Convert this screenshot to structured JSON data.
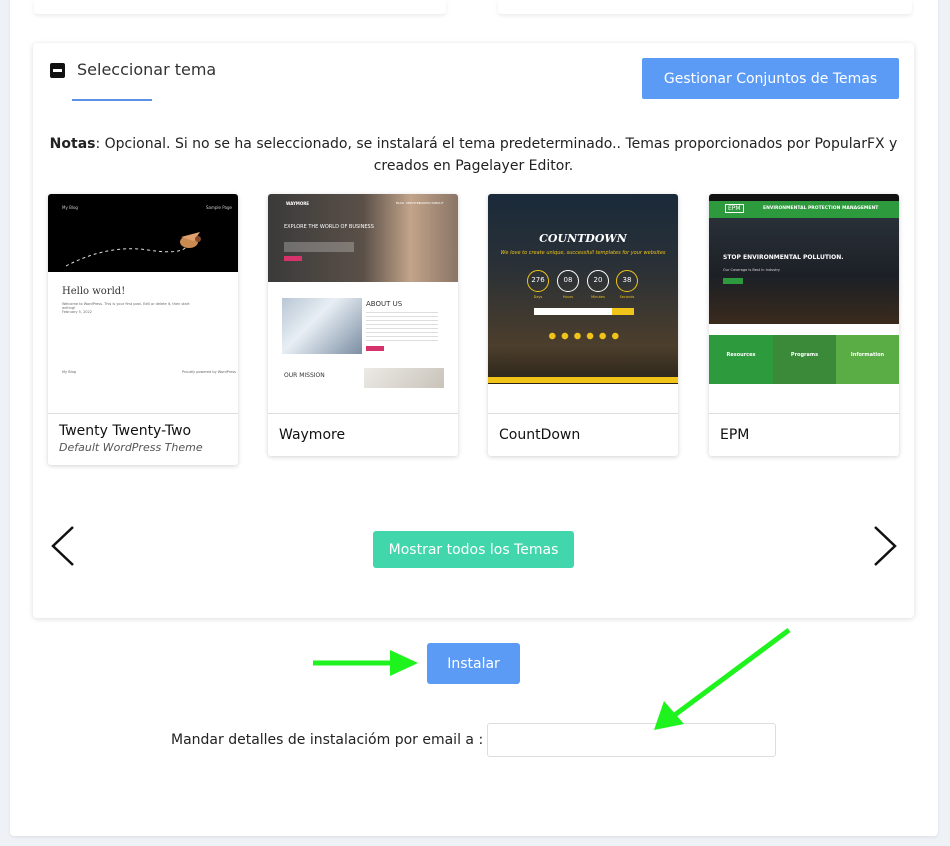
{
  "section": {
    "title": "Seleccionar tema",
    "manage_button": "Gestionar Conjuntos de Temas"
  },
  "notes": {
    "label": "Notas",
    "text": ": Opcional. Si no se ha seleccionado, se instalará el tema predeterminado.. Temas proporcionados por PopularFX y creados en Pagelayer Editor."
  },
  "themes": [
    {
      "name": "Twenty Twenty-Two",
      "description": "Default WordPress Theme",
      "preview": {
        "site_name": "My Blog",
        "top_link": "Sample Page",
        "heading": "Hello world!",
        "body": "Welcome to WordPress. This is your first post. Edit or delete it, then start writing!",
        "date": "February 5, 2022",
        "footer_left": "My Blog",
        "footer_right": "Proudly powered by WordPress"
      }
    },
    {
      "name": "Waymore",
      "description": "",
      "preview": {
        "logo": "WAYMORE",
        "nav": [
          "BLOG",
          "SERVICES",
          "CONTACT",
          "ABOUT"
        ],
        "hero": "EXPLORE THE WORLD OF BUSINESS",
        "about": "ABOUT US",
        "mission": "OUR MISSION"
      }
    },
    {
      "name": "CountDown",
      "description": "",
      "preview": {
        "title": "COUNTDOWN",
        "tagline": "We love to create unique, successfull templates for your websites",
        "counts": [
          "276",
          "08",
          "20",
          "38"
        ],
        "units": [
          "Days",
          "Hours",
          "Minutes",
          "Seconds"
        ]
      }
    },
    {
      "name": "EPM",
      "description": "",
      "preview": {
        "logo": "EPM",
        "banner": "ENVIRONMENTAL PROTECTION MANAGEMENT",
        "hero": "STOP ENVIRONMENTAL POLLUTION.",
        "sub": "Our Coverage Is Best In Industry",
        "columns": [
          "Resources",
          "Programs",
          "Information"
        ]
      }
    }
  ],
  "carousel": {
    "show_all_button": "Mostrar todos los Temas"
  },
  "install": {
    "button": "Instalar",
    "email_label": "Mandar detalles de instalacióm por email a :",
    "email_value": "",
    "email_placeholder": ""
  },
  "colors": {
    "primary_blue": "#5b9bf6",
    "teal": "#42d6ac",
    "annotation_green": "#1ef31e"
  },
  "icons": [
    "minus-square-icon",
    "chevron-left-icon",
    "chevron-right-icon"
  ]
}
